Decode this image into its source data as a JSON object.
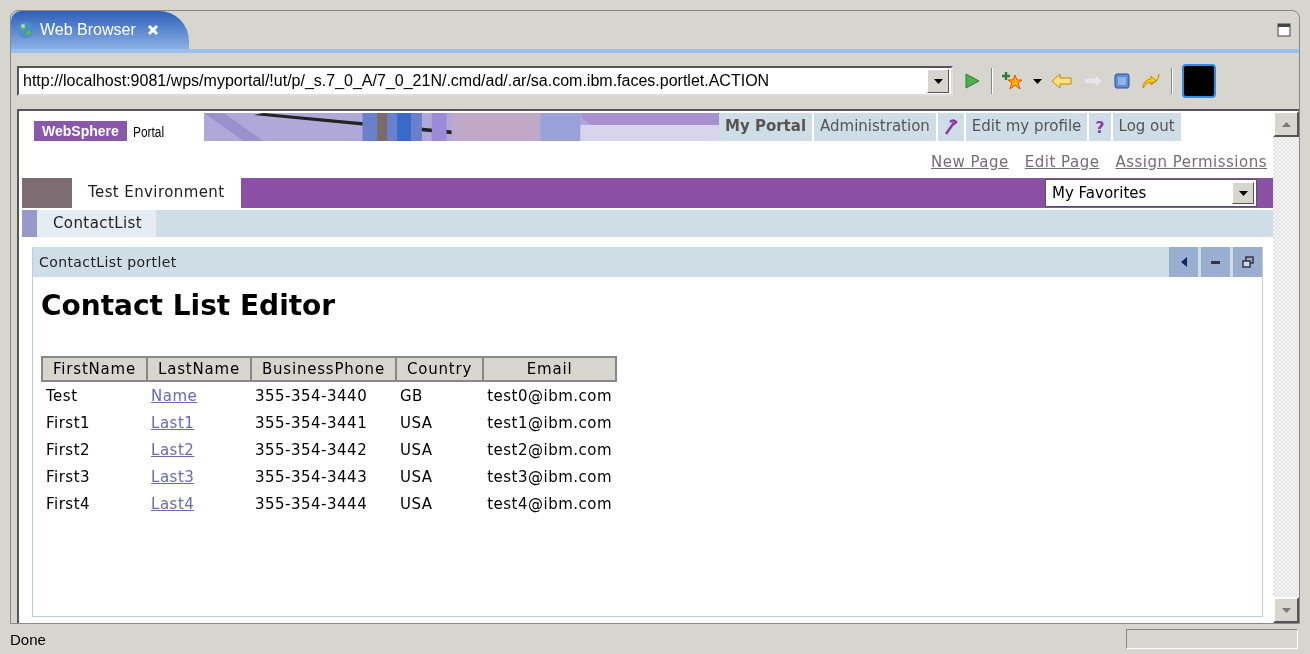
{
  "editor_tab": {
    "title": "Web Browser",
    "selected": true
  },
  "toolbar": {
    "url": "http://localhost:9081/wps/myportal/!ut/p/_s.7_0_A/7_0_21N/.cmd/ad/.ar/sa.com.ibm.faces.portlet.ACTION",
    "forward_disabled": true
  },
  "portal": {
    "logo": "WebSphere",
    "logo_suffix": "Portal",
    "nav": [
      {
        "kind": "text",
        "label": "My Portal",
        "selected": true
      },
      {
        "kind": "text",
        "label": "Administration",
        "selected": false
      },
      {
        "kind": "wrench"
      },
      {
        "kind": "text",
        "label": "Edit my profile",
        "selected": false
      },
      {
        "kind": "glyph",
        "label": "?"
      },
      {
        "kind": "text",
        "label": "Log out",
        "selected": false
      }
    ],
    "page_links": [
      "New Page",
      "Edit Page",
      "Assign Permissions"
    ],
    "place_tabs": [
      {
        "label": "Test Environment",
        "selected": true
      }
    ],
    "favorites": {
      "value": "My Favorites"
    },
    "page_tabs": [
      {
        "label": "ContactList",
        "selected": true
      }
    ]
  },
  "portlet": {
    "title": "ContactList portlet",
    "heading": "Contact List Editor",
    "columns": [
      "FirstName",
      "LastName",
      "BusinessPhone",
      "Country",
      "Email"
    ],
    "rows": [
      {
        "first_name": "Test",
        "last_name": "Name",
        "phone": "355-354-3440",
        "country": "GB",
        "email": "test0@ibm.com"
      },
      {
        "first_name": "First1",
        "last_name": "Last1",
        "phone": "355-354-3441",
        "country": "USA",
        "email": "test1@ibm.com"
      },
      {
        "first_name": "First2",
        "last_name": "Last2",
        "phone": "355-354-3442",
        "country": "USA",
        "email": "test2@ibm.com"
      },
      {
        "first_name": "First3",
        "last_name": "Last3",
        "phone": "355-354-3443",
        "country": "USA",
        "email": "test3@ibm.com"
      },
      {
        "first_name": "First4",
        "last_name": "Last4",
        "phone": "355-354-3444",
        "country": "USA",
        "email": "test4@ibm.com"
      }
    ]
  },
  "status_bar": {
    "text": "Done"
  }
}
